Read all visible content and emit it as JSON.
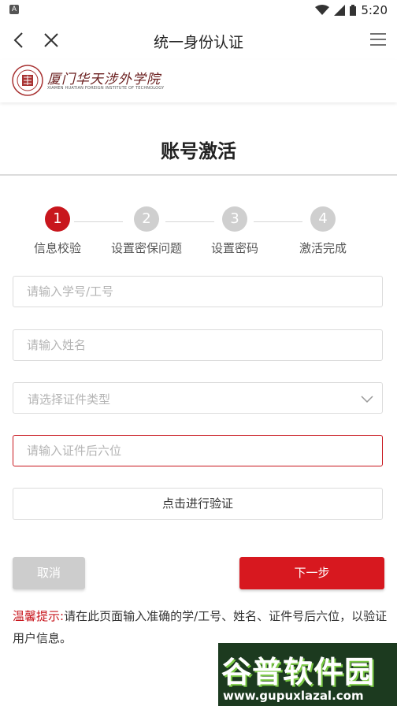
{
  "status_bar": {
    "notification_icon": "a-notification-icon",
    "wifi_icon": "wifi-icon",
    "signal_icon": "signal-icon",
    "battery_icon": "battery-icon",
    "time": "5:20"
  },
  "nav": {
    "title": "统一身份认证",
    "back_icon": "back-chevron-icon",
    "close_icon": "close-icon",
    "menu_icon": "hamburger-menu-icon"
  },
  "logo": {
    "name_cn": "厦门华天涉外学院",
    "name_en": "XIAMEN HUATIAN FOREIGN INSTITUTE OF TECHNOLOGY"
  },
  "page": {
    "title": "账号激活"
  },
  "steps": [
    {
      "number": "1",
      "label": "信息校验",
      "active": true
    },
    {
      "number": "2",
      "label": "设置密保问题",
      "active": false
    },
    {
      "number": "3",
      "label": "设置密码",
      "active": false
    },
    {
      "number": "4",
      "label": "激活完成",
      "active": false
    }
  ],
  "form": {
    "student_id_placeholder": "请输入学号/工号",
    "name_placeholder": "请输入姓名",
    "id_type_placeholder": "请选择证件类型",
    "id_last6_placeholder": "请输入证件后六位",
    "verify_button": "点击进行验证"
  },
  "actions": {
    "cancel": "取消",
    "next": "下一步"
  },
  "tip": {
    "label": "温馨提示:",
    "text": "请在此页面输入准确的学/工号、姓名、证件号后六位，以验证用户信息。"
  },
  "watermark": {
    "brand": "谷普软件园",
    "url": "www.gupuxlazal.com"
  },
  "colors": {
    "accent": "#d7181f",
    "inactive_step": "#cfcfcf",
    "border": "#dcdcdc"
  }
}
